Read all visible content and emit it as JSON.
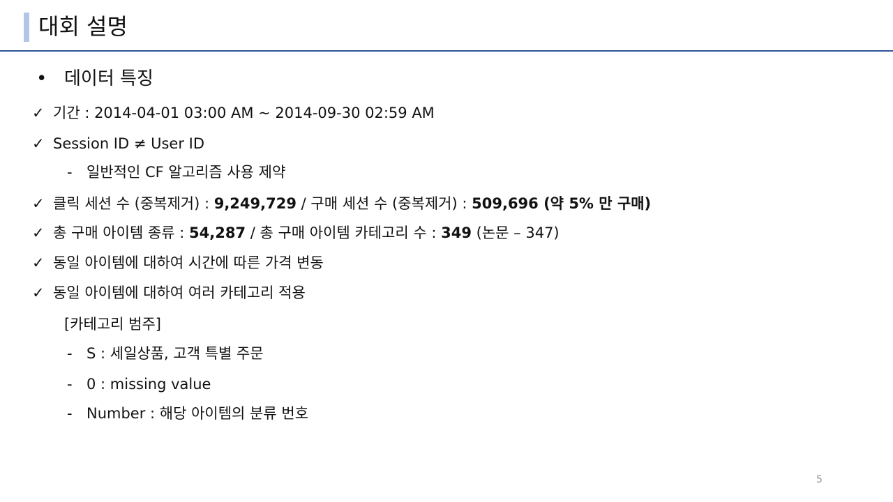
{
  "slide": {
    "title": "대회 설명",
    "page_number": "5"
  },
  "section": {
    "bullet": "•",
    "heading": "데이터 특징"
  },
  "check_mark": "✓",
  "dash": "-",
  "lines": {
    "period": "기간 : 2014-04-01 03:00 AM ~ 2014-09-30 02:59 AM",
    "session": "Session ID ≠ User ID",
    "session_sub": "일반적인 CF 알고리즘 사용 제약",
    "clicks": {
      "a": "클릭 세션 수 (중복제거) : ",
      "b": "9,249,729",
      "c": " / 구매 세션 수 (중복제거) : ",
      "d": "509,696 (약 5% 만 구매)"
    },
    "items": {
      "a": "총 구매 아이템 종류 : ",
      "b": "54,287",
      "c": " / 총 구매 아이템 카테고리 수 : ",
      "d": "349",
      "e": " (논문 – 347)"
    },
    "price": "동일 아이템에 대하여 시간에 따른 가격 변동",
    "category": "동일 아이템에 대하여 여러 카테고리 적용",
    "category_heading": "[카테고리 범주]",
    "category_s": "S : 세일상품, 고객 특별 주문",
    "category_0": "0 : missing value",
    "category_number": "Number : 해당 아이템의 분류 번호"
  }
}
